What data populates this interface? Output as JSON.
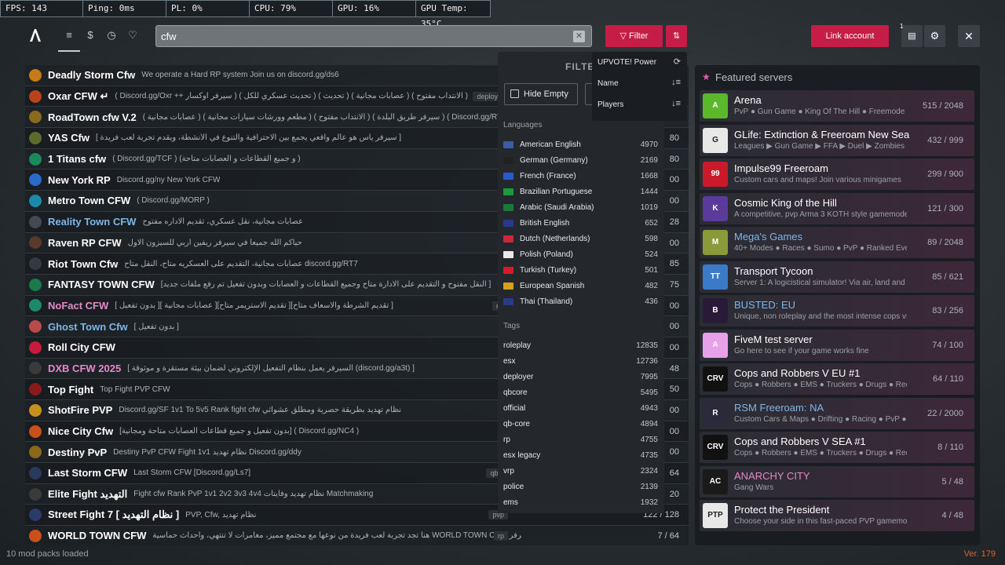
{
  "stats": [
    "FPS: 143",
    "Ping: 0ms",
    "PL: 0%",
    "CPU: 79%",
    "GPU: 16%",
    "GPU Temp: 35°C"
  ],
  "search": {
    "value": "cfw"
  },
  "toolbar": {
    "filter_label": "Filter",
    "link_account_label": "Link account",
    "notif_count": "1"
  },
  "servers": [
    {
      "name": "Deadly Storm Cfw",
      "desc": "We operate a Hard RP system Join us on discord.gg/ds6",
      "players": "",
      "icon_color": "#c77a16",
      "name_style": ""
    },
    {
      "name": "Oxar CFW ↵",
      "desc": "( Discord.gg/Oxr ++ سيرفر أوكسار ) ( تحديث عسكري للكل ) ( تحديث ) ( عصابات مجانية ) ( الانتداب مفتوح )",
      "tag": "deployer",
      "players": "",
      "icon_color": "#b8431b",
      "name_style": ""
    },
    {
      "name": "RoadTown cfw V.2",
      "desc": "( عصابات مجانية ) ( مطعم وورشات سيارات مجانية ) ( الانتداب مفتوح ) ( سيرفر طريق البلدة ) ( Discord.gg/RT4 )",
      "players": "",
      "icon_color": "#8a6b1e",
      "name_style": ""
    },
    {
      "name": "YAS Cfw",
      "desc": "[ سيرفر ياس هو عالم واقعي يجمع بين الاحترافية والتنوع في الأنشطة، ويقدم تجربة لعب فريدة ]",
      "players": "80",
      "icon_color": "#5a6b2a",
      "name_style": ""
    },
    {
      "name": "1 Titans cfw",
      "desc": "( Discord.gg/TCF ) (و جميع القطاعات و العصابات متاحة )",
      "players": "80",
      "icon_color": "#1a8a5a",
      "name_style": ""
    },
    {
      "name": "New York RP",
      "desc": "Discord.gg/ny New York CFW",
      "players": "00",
      "icon_color": "#2a6ac8",
      "name_style": ""
    },
    {
      "name": "Metro Town CFW",
      "desc": "( Discord.gg/MORP )",
      "players": "00",
      "icon_color": "#1a8aa8",
      "name_style": ""
    },
    {
      "name": "Reality Town CFW",
      "desc": "عصابات مجانية، نقل عسكري، تقديم الاداره مفتوح",
      "players": "28",
      "icon_color": "#444a52",
      "name_style": "blue"
    },
    {
      "name": "Raven RP CFW",
      "desc": "حياكم الله جميعا في سيرفر ريفين اربي للسيزون الاول",
      "players": "00",
      "icon_color": "#5a3a2a",
      "name_style": ""
    },
    {
      "name": "Riot Town Cfw",
      "desc": "عصابات مجانية، التقديم على العسكريه متاح، النقل متاح discord.gg/RT7",
      "players": "85",
      "icon_color": "#333a42",
      "name_style": ""
    },
    {
      "name": "FANTASY TOWN CFW",
      "desc": "[النقل مفتوح و التقديم على الادارة متاح وجميع القطاعات و العصابات وبدون تفعيل تم رفع ملفات جديد ]",
      "players": "75",
      "icon_color": "#1a7a4a",
      "name_style": ""
    },
    {
      "name": "NoFact CFW",
      "desc": "[ بدون تفعيل ][ عصابات مجانية ][تقديم الاستريمر متاح ][تقديم الشرطة والاسعاف متاح ]",
      "tag": "rol",
      "players": "00",
      "icon_color": "#1a8a6a",
      "name_style": "pink"
    },
    {
      "name": "Ghost Town Cfw",
      "desc": "[ بدون تفعيل ]",
      "players": "00",
      "icon_color": "#b84a4a",
      "name_style": "blue"
    },
    {
      "name": "Roll City CFW",
      "desc": "",
      "players": "00",
      "icon_color": "#c81a3a",
      "name_style": ""
    },
    {
      "name": "DXB CFW 2025",
      "desc": "[ السيرفر يعمل بنظام التفعيل الإلكتروني لضمان بيئة مستقرة و موثوقة (discord.gg/a3t) ]",
      "players": "48",
      "icon_color": "#3a3a3a",
      "name_style": "pink"
    },
    {
      "name": "Top Fight",
      "desc": "Top Fight PVP CFW",
      "players": "50",
      "icon_color": "#8a1a1a",
      "name_style": ""
    },
    {
      "name": "ShotFire PVP",
      "desc": "Discord.gg/SF 1v1 To 5v5 Rank fight cfw نظام تهديد بطريقة حصرية ومطلق عشوائي",
      "players": "00",
      "icon_color": "#c8901a",
      "name_style": ""
    },
    {
      "name": "Nice City Cfw",
      "desc": "[بدون تفعيل و جميع قطاعات العصابات متاحة ومجانية] ( Discord.gg/NC4 )",
      "players": "00",
      "icon_color": "#c8501a",
      "name_style": ""
    },
    {
      "name": "Destiny PvP",
      "desc": "Destiny PvP CFW Fight 1v1 نظام تهديد Discord.gg/ddy",
      "players": "00",
      "icon_color": "#8a6a1a",
      "name_style": ""
    },
    {
      "name": "Last Storm CFW",
      "desc": "Last Storm CFW [Discord.gg/Ls7]",
      "tag": "qb-c",
      "players": "64",
      "icon_color": "#2a3a5a",
      "name_style": ""
    },
    {
      "name": "Elite Fight التهديد",
      "desc": "Fight cfw Rank PvP 1v1 2v2 3v3 4v4 نظام تهديد وفايتات Matchmaking",
      "players": "20",
      "icon_color": "#3a3a3a",
      "name_style": ""
    },
    {
      "name": "Street Fight 7 [ نظام التهديد ]",
      "desc": "PVP, Cfw, نظام تهديد",
      "tag": "pvp",
      "players": "122 / 128",
      "icon_color": "#2a3a6a",
      "name_style": ""
    },
    {
      "name": "WORLD TOWN CFW",
      "desc": "هنا تجد تجربة لعب فريدة من نوعها مع مجتمع مميز، مغامرات لا تنتهي، وأحداث حماسية WORLD TOWN CFW مرحبًا بك في سيرفر",
      "tag": "rp",
      "players": "7 / 64",
      "icon_color": "#c8501a",
      "name_style": ""
    }
  ],
  "footer": {
    "mods": "10 mod packs loaded",
    "version": "Ver. 179"
  },
  "filter_panel": {
    "title": "FILTE",
    "hide_empty": "Hide Empty",
    "languages_label": "Languages",
    "languages": [
      {
        "name": "American English",
        "count": "4970",
        "flag": "#3b5ba8"
      },
      {
        "name": "German (Germany)",
        "count": "2169",
        "flag": "#222222"
      },
      {
        "name": "French (France)",
        "count": "1668",
        "flag": "#2a5ac8"
      },
      {
        "name": "Brazilian Portuguese",
        "count": "1444",
        "flag": "#1a9a3a"
      },
      {
        "name": "Arabic (Saudi Arabia)",
        "count": "1019",
        "flag": "#1a7a3a"
      },
      {
        "name": "British English",
        "count": "652",
        "flag": "#2a3a8a"
      },
      {
        "name": "Dutch (Netherlands)",
        "count": "598",
        "flag": "#c8283a"
      },
      {
        "name": "Polish (Poland)",
        "count": "524",
        "flag": "#e8e8e8"
      },
      {
        "name": "Turkish (Turkey)",
        "count": "501",
        "flag": "#d81a2a"
      },
      {
        "name": "European Spanish",
        "count": "482",
        "flag": "#d8a01a"
      },
      {
        "name": "Thai (Thailand)",
        "count": "436",
        "flag": "#2a3a8a"
      }
    ],
    "tags_label": "Tags",
    "tags": [
      {
        "name": "roleplay",
        "count": "12835"
      },
      {
        "name": "esx",
        "count": "12736"
      },
      {
        "name": "deployer",
        "count": "7995"
      },
      {
        "name": "qbcore",
        "count": "5495"
      },
      {
        "name": "official",
        "count": "4943"
      },
      {
        "name": "qb-core",
        "count": "4894"
      },
      {
        "name": "rp",
        "count": "4755"
      },
      {
        "name": "esx legacy",
        "count": "4735"
      },
      {
        "name": "vrp",
        "count": "2324"
      },
      {
        "name": "police",
        "count": "2139"
      },
      {
        "name": "ems",
        "count": "1932"
      }
    ]
  },
  "sort_menu": [
    {
      "label": "UPVOTE! Power",
      "icon": "⟳"
    },
    {
      "label": "Name",
      "icon": "↓≡"
    },
    {
      "label": "Players",
      "icon": "↓≡"
    }
  ],
  "featured": {
    "title": "Featured servers",
    "servers": [
      {
        "name": "Arena",
        "desc": "PvP ● Gun Game ● King Of The Hill ● Freemode",
        "players": "515 / 2048",
        "icon_color": "#5ab82a",
        "icon_text": "A",
        "style": ""
      },
      {
        "name": "GLife: Extinction & Freeroam New Sea",
        "desc": "Leagues ▶ Gun Game ▶ FFA ▶ Duel ▶ Zombies",
        "players": "432 / 999",
        "icon_color": "#e8e8e8",
        "icon_text": "G",
        "style": ""
      },
      {
        "name": "Impulse99 Freeroam",
        "desc": "Custom cars and maps! Join various minigames",
        "players": "299 / 900",
        "icon_color": "#c81a2a",
        "icon_text": "99",
        "style": ""
      },
      {
        "name": "Cosmic King of the Hill",
        "desc": "A competitive, pvp Arma 3 KOTH style gamemode",
        "players": "121 / 300",
        "icon_color": "#5a3a9a",
        "icon_text": "K",
        "style": ""
      },
      {
        "name": "Mega's Games",
        "desc": "40+ Modes ● Races ● Sumo ● PvP ● Ranked Events",
        "players": "89 / 2048",
        "icon_color": "#8a9a3a",
        "icon_text": "M",
        "style": "blue"
      },
      {
        "name": "Transport Tycoon",
        "desc": "Server 1: A logicistical simulator! Via air, land and sea",
        "players": "85 / 621",
        "icon_color": "#3a7ac8",
        "icon_text": "TT",
        "style": ""
      },
      {
        "name": "BUSTED: EU",
        "desc": "Unique, non roleplay and the most intense cops vs robbers",
        "players": "83 / 256",
        "icon_color": "#2a1a3a",
        "icon_text": "B",
        "style": "blue"
      },
      {
        "name": "FiveM test server",
        "desc": "Go here to see if your game works fine",
        "players": "74 / 100",
        "icon_color": "#e8a0e8",
        "icon_text": "A",
        "style": ""
      },
      {
        "name": "Cops and Robbers V EU #1",
        "desc": "Cops ● Robbers ● EMS ● Truckers ● Drugs ● Redzones",
        "players": "64 / 110",
        "icon_color": "#111111",
        "icon_text": "CRV",
        "style": ""
      },
      {
        "name": "RSM Freeroam: NA",
        "desc": "Custom Cars & Maps ● Drifting ● Racing ● PvP ● Events",
        "players": "22 / 2000",
        "icon_color": "#2a2a3a",
        "icon_text": "R",
        "style": "blue"
      },
      {
        "name": "Cops and Robbers V SEA #1",
        "desc": "Cops ● Robbers ● EMS ● Truckers ● Drugs ● Redzones",
        "players": "8 / 110",
        "icon_color": "#111111",
        "icon_text": "CRV",
        "style": ""
      },
      {
        "name": "ANARCHY CITY",
        "desc": "Gang Wars",
        "players": "5 / 48",
        "icon_color": "#1a1a1a",
        "icon_text": "AC",
        "style": "pink"
      },
      {
        "name": "Protect the President",
        "desc": "Choose your side in this fast-paced PVP gamemode",
        "players": "4 / 48",
        "icon_color": "#e8e8e8",
        "icon_text": "PTP",
        "style": ""
      }
    ]
  }
}
